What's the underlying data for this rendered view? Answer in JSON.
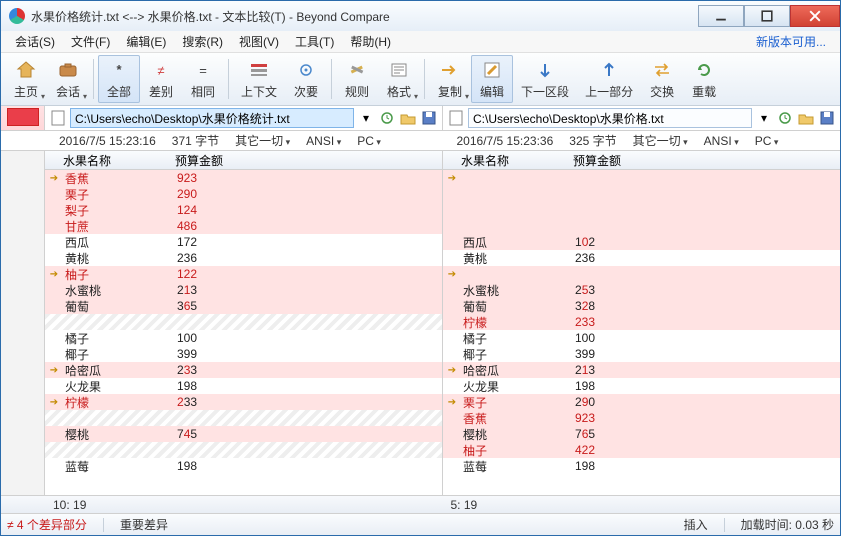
{
  "title": "水果价格统计.txt <--> 水果价格.txt - 文本比较(T) - Beyond Compare",
  "menu": {
    "items": [
      "会话(S)",
      "文件(F)",
      "编辑(E)",
      "搜索(R)",
      "视图(V)",
      "工具(T)",
      "帮助(H)"
    ],
    "update": "新版本可用..."
  },
  "toolbar": {
    "home": "主页",
    "session": "会话",
    "all": "全部",
    "diff": "差别",
    "same": "相同",
    "context": "上下文",
    "minor": "次要",
    "rules": "规则",
    "format": "格式",
    "copy": "复制",
    "edit": "编辑",
    "next": "下一区段",
    "prev": "上一部分",
    "swap": "交换",
    "reload": "重载"
  },
  "left": {
    "path": "C:\\Users\\echo\\Desktop\\水果价格统计.txt",
    "date": "2016/7/5 15:23:16",
    "size": "371 字节",
    "rest": "其它一切",
    "enc": "ANSI",
    "plat": "PC",
    "header": {
      "c1": "水果名称",
      "c2": "预算金额"
    },
    "rows": [
      {
        "t": "del",
        "mk": "➔",
        "c1": "香蕉",
        "c2": "923"
      },
      {
        "t": "del",
        "c1": "栗子",
        "c2": "290"
      },
      {
        "t": "del",
        "c1": "梨子",
        "c2": "124"
      },
      {
        "t": "del",
        "c1": "甘蔗",
        "c2": "486"
      },
      {
        "t": "nrm",
        "c1": "西瓜",
        "c2": "172"
      },
      {
        "t": "nrm",
        "c1": "黄桃",
        "c2": "236"
      },
      {
        "t": "del",
        "mk": "➔",
        "c1": "柚子",
        "c2": "122"
      },
      {
        "t": "diff",
        "c1": "水蜜桃",
        "c2mix": [
          {
            "b": "2"
          },
          {
            "r": "1"
          },
          {
            "b": "3"
          }
        ]
      },
      {
        "t": "diff",
        "c1": "葡萄",
        "c2mix": [
          {
            "b": "3"
          },
          {
            "r": "6"
          },
          {
            "b": "5"
          }
        ]
      },
      {
        "t": "hatch"
      },
      {
        "t": "nrm",
        "c1": "橘子",
        "c2": "100"
      },
      {
        "t": "nrm",
        "c1": "椰子",
        "c2": "399"
      },
      {
        "t": "diff",
        "mk": "➔",
        "c1": "哈密瓜",
        "c2mix": [
          {
            "b": "2"
          },
          {
            "r": "3"
          },
          {
            "b": "3"
          }
        ]
      },
      {
        "t": "nrm",
        "c1": "火龙果",
        "c2": "198"
      },
      {
        "t": "diff",
        "mk": "➔",
        "c1r": "柠檬",
        "c2mix": [
          {
            "r": "2"
          },
          {
            "b": "33"
          }
        ]
      },
      {
        "t": "hatch"
      },
      {
        "t": "diff",
        "c1": "樱桃",
        "c2mix": [
          {
            "b": "7"
          },
          {
            "r": "4"
          },
          {
            "b": "5"
          }
        ]
      },
      {
        "t": "hatch"
      },
      {
        "t": "nrm",
        "c1": "蓝莓",
        "c2": "198"
      }
    ],
    "cursor": "10: 19"
  },
  "right": {
    "path": "C:\\Users\\echo\\Desktop\\水果价格.txt",
    "date": "2016/7/5 15:23:36",
    "size": "325 字节",
    "rest": "其它一切",
    "enc": "ANSI",
    "plat": "PC",
    "header": {
      "c1": "水果名称",
      "c2": "预算金额"
    },
    "rows": [
      {
        "t": "gap",
        "mk": "➔"
      },
      {
        "t": "gap"
      },
      {
        "t": "gap"
      },
      {
        "t": "gap"
      },
      {
        "t": "diff",
        "c1": "西瓜",
        "c2mix": [
          {
            "b": "1"
          },
          {
            "r": "0"
          },
          {
            "b": "2"
          }
        ]
      },
      {
        "t": "nrm",
        "c1": "黄桃",
        "c2": "236"
      },
      {
        "t": "gap",
        "mk": "➔"
      },
      {
        "t": "diff",
        "c1": "水蜜桃",
        "c2mix": [
          {
            "b": "2"
          },
          {
            "r": "5"
          },
          {
            "b": "3"
          }
        ]
      },
      {
        "t": "diff",
        "c1": "葡萄",
        "c2mix": [
          {
            "b": "3"
          },
          {
            "r": "2"
          },
          {
            "b": "8"
          }
        ]
      },
      {
        "t": "del",
        "c1": "柠檬",
        "c2": "233"
      },
      {
        "t": "nrm",
        "c1": "橘子",
        "c2": "100"
      },
      {
        "t": "nrm",
        "c1": "椰子",
        "c2": "399"
      },
      {
        "t": "diff",
        "mk": "➔",
        "c1": "哈密瓜",
        "c2mix": [
          {
            "b": "2"
          },
          {
            "r": "1"
          },
          {
            "b": "3"
          }
        ]
      },
      {
        "t": "nrm",
        "c1": "火龙果",
        "c2": "198"
      },
      {
        "t": "diff",
        "mk": "➔",
        "c1r": "栗子",
        "c2mix": [
          {
            "b": "2"
          },
          {
            "r": "9"
          },
          {
            "b": "0"
          }
        ]
      },
      {
        "t": "del",
        "c1": "香蕉",
        "c2": "923"
      },
      {
        "t": "diff",
        "c1": "樱桃",
        "c2mix": [
          {
            "b": "7"
          },
          {
            "r": "6"
          },
          {
            "b": "5"
          }
        ]
      },
      {
        "t": "del",
        "c1": "柚子",
        "c2": "422"
      },
      {
        "t": "nrm",
        "c1": "蓝莓",
        "c2": "198"
      }
    ],
    "cursor": "5: 19"
  },
  "status": {
    "diffCount": "4 个差异部分",
    "important": "重要差异",
    "insert": "插入",
    "loadTime": "加载时间: 0.03 秒"
  }
}
